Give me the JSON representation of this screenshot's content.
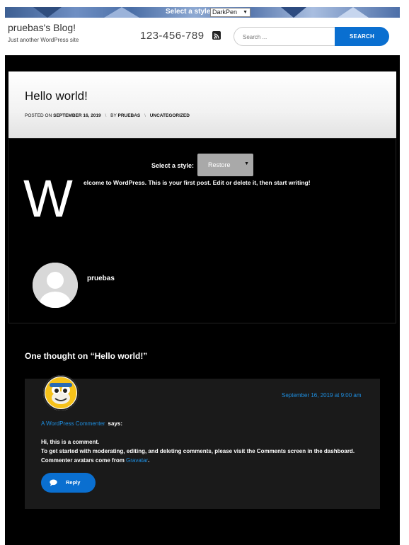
{
  "stylebar": {
    "label": "Select a style:",
    "selected": "DarkPen"
  },
  "header": {
    "site_title": "pruebas's Blog!",
    "tagline": "Just another WordPress site",
    "phone": "123-456-789",
    "rss_icon": "rss-icon",
    "search_placeholder": "Search ...",
    "search_button": "SEARCH"
  },
  "post": {
    "title": "Hello world!",
    "meta": {
      "posted_on_label": "POSTED ON",
      "date": "SEPTEMBER 16, 2019",
      "separator": "\\",
      "by_label": "BY",
      "author": "PRUEBAS",
      "category": "UNCATEGORIZED"
    },
    "style_select": {
      "label": "Select a style:",
      "selected": "Restore"
    },
    "dropcap": "W",
    "content": "elcome to WordPress. This is your first post. Edit or delete it, then start writing!",
    "author_name": "pruebas"
  },
  "comments": {
    "title": "One thought on “Hello world!”",
    "items": [
      {
        "author": "A WordPress Commenter",
        "says": "says:",
        "date": "September 16, 2019 at 9:00 am",
        "line1": "Hi, this is a comment.",
        "line2": "To get started with moderating, editing, and deleting comments, please visit the Comments screen in the dashboard.",
        "line3_prefix": "Commenter avatars come from ",
        "line3_link": "Gravatar",
        "line3_suffix": ".",
        "reply": "Reply"
      }
    ]
  },
  "colors": {
    "accent": "#0a6fd0",
    "link": "#1e8fe1",
    "page_bg": "#000000"
  }
}
